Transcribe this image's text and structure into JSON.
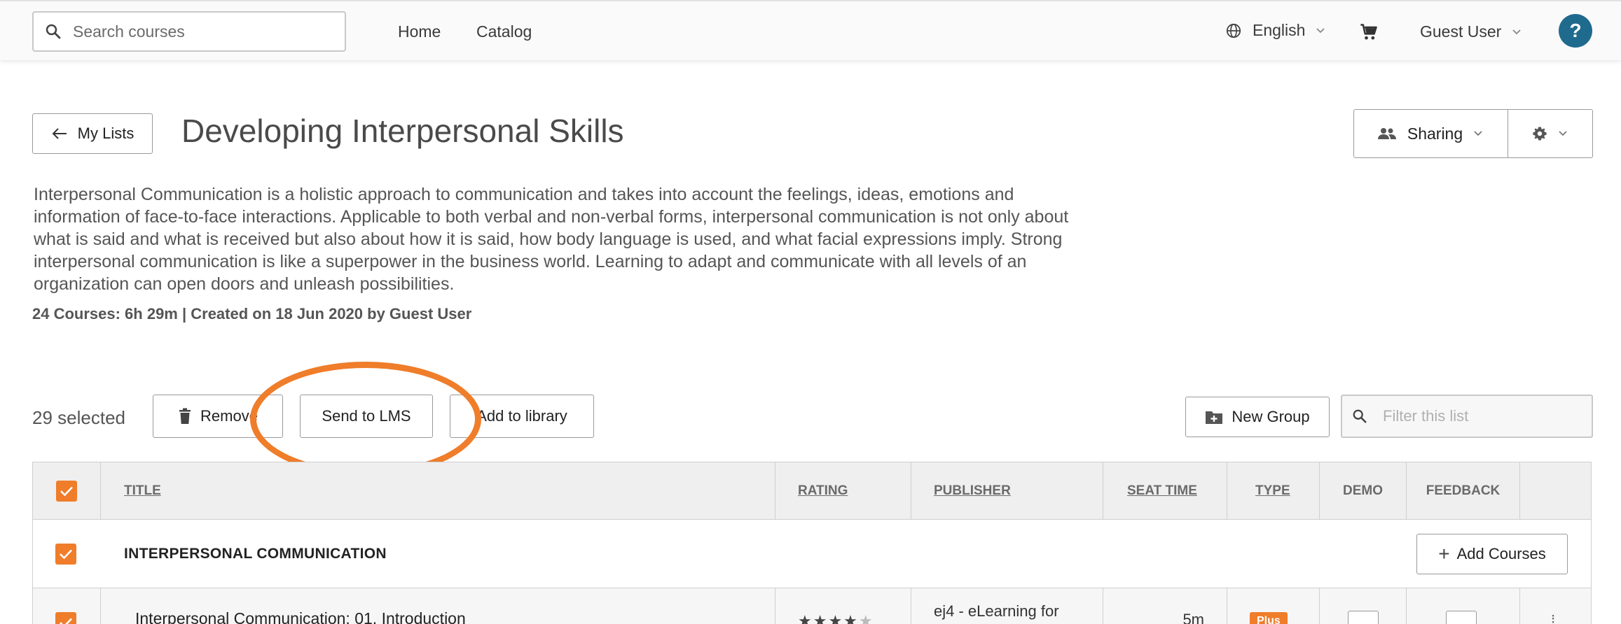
{
  "nav": {
    "search_placeholder": "Search courses",
    "links": [
      "Home",
      "Catalog"
    ],
    "language": "English",
    "user": "Guest User",
    "help": "?"
  },
  "header": {
    "back_label": "My Lists",
    "title": "Developing Interpersonal Skills",
    "sharing_label": "Sharing",
    "description": "Interpersonal Communication is a holistic approach to communication and takes into account the feelings, ideas, emotions and information of face-to-face interactions. Applicable to both verbal and non-verbal forms, interpersonal communication is not only about what is said and what is received but also about how it is said, how body language is used, and what facial expressions imply. Strong interpersonal communication is like a superpower in the business world. Learning to adapt and communicate with all levels of an organization can open doors and unleash possibilities.",
    "meta": "24 Courses: 6h 29m | Created on 18 Jun 2020 by Guest User"
  },
  "actions": {
    "selected": "29 selected",
    "remove": "Remove",
    "send_to_lms": "Send to LMS",
    "add_to_library": "Add to library",
    "new_group": "New Group",
    "filter_placeholder": "Filter this list"
  },
  "table": {
    "columns": {
      "title": "TITLE",
      "rating": "RATING",
      "publisher": "PUBLISHER",
      "seat_time": "SEAT TIME",
      "type": "TYPE",
      "demo": "DEMO",
      "feedback": "FEEDBACK"
    },
    "group": {
      "name": "INTERPERSONAL COMMUNICATION",
      "add_courses": "Add Courses"
    },
    "rows": [
      {
        "title": "Interpersonal Communication: 01. Introduction",
        "rating_stars": 4,
        "publisher": "ej4 - eLearning for",
        "seat_time": "5m",
        "type": "Plus"
      }
    ]
  },
  "colors": {
    "accent_orange": "#ef7d2a",
    "help_blue": "#1f6b8e"
  }
}
